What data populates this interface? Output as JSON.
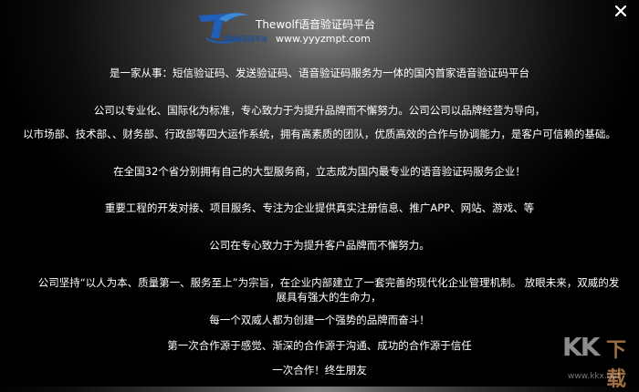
{
  "header": {
    "logo_caption": "湛狼验证码平台",
    "title": "Thewolf语音验证码平台",
    "url": "www.yyyzmpt.com"
  },
  "window": {
    "close_label": "×"
  },
  "content": {
    "lines": [
      "是一家从事：短信验证码、发送验证码、语音验证码服务为一体的国内首家语音验证码平台",
      "公司以专业化、国际化为标准，专心致力于为提升品牌而不懈努力。公司公司以品牌经营为导向，",
      "以市场部、技术部、、财务部、行政部等四大运作系统，拥有高素质的团队，优质高效的合作与协调能力，是客户可信赖的基础。",
      "在全国32个省分别拥有自己的大型服务商，立志成为国内最专业的语音验证码服务企业！",
      "重要工程的开发对接、项目服务、专注为企业提供真实注册信息、推广APP、网站、游戏、等",
      "公司在专心致力于为提升客户品牌而不懈努力。",
      "公司坚持“以人为本、质量第一、服务至上”为宗旨，在企业内部建立了一套完善的现代化企业管理机制。 放眼未来，双威的发展具有强大的生命力，",
      "每一个双威人都为创建一个强势的品牌而奋斗！",
      "第一次合作源于感觉、渐深的合作源于沟通、成功的合作源于信任",
      "一次合作！终生朋友"
    ]
  },
  "watermark": {
    "kk": "KK",
    "xia": "下载",
    "url": "www.kkx.net"
  }
}
